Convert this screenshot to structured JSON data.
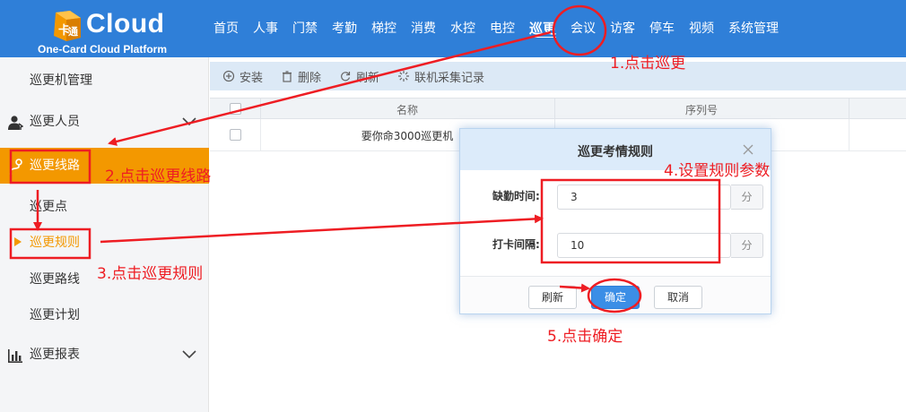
{
  "header": {
    "logo_word": "Cloud",
    "logo_sub": "One-Card Cloud Platform",
    "nav": [
      {
        "label": "首页"
      },
      {
        "label": "人事"
      },
      {
        "label": "门禁"
      },
      {
        "label": "考勤"
      },
      {
        "label": "梯控"
      },
      {
        "label": "消费"
      },
      {
        "label": "水控"
      },
      {
        "label": "电控"
      },
      {
        "label": "巡更",
        "active": true
      },
      {
        "label": "会议"
      },
      {
        "label": "访客"
      },
      {
        "label": "停车"
      },
      {
        "label": "视频"
      },
      {
        "label": "系统管理"
      }
    ]
  },
  "sidebar": {
    "items": [
      {
        "label": "巡更机管理"
      },
      {
        "label": "巡更人员",
        "icon": "user-icon"
      },
      {
        "label": "巡更线路",
        "icon": "route-icon",
        "selected": true
      },
      {
        "label": "巡更点"
      },
      {
        "label": "巡更规则",
        "active": true
      },
      {
        "label": "巡更路线"
      },
      {
        "label": "巡更计划"
      },
      {
        "label": "巡更报表",
        "icon": "report-icon"
      }
    ]
  },
  "toolbar": {
    "install": "安装",
    "delete": "删除",
    "refresh": "刷新",
    "records": "联机采集记录"
  },
  "table": {
    "columns": [
      "名称",
      "序列号"
    ],
    "rows": [
      {
        "name": "要你命3000巡更机",
        "serial": ""
      }
    ]
  },
  "dialog": {
    "title": "巡更考情规则",
    "fields": [
      {
        "label": "缺勤时间:",
        "value": "3",
        "unit": "分"
      },
      {
        "label": "打卡间隔:",
        "value": "10",
        "unit": "分"
      }
    ],
    "buttons": {
      "refresh": "刷新",
      "confirm": "确定",
      "cancel": "取消"
    }
  },
  "annotations": {
    "step1": "1.点击巡更",
    "step2": "2.点击巡更线路",
    "step3": "3.点击巡更规则",
    "step4": "4.设置规则参数",
    "step5": "5.点击确定",
    "color": "#ee1d23"
  },
  "colors": {
    "header": "#2f7fd8",
    "sidebar_selected": "#f39800",
    "primary_button": "#3b8ee6"
  }
}
